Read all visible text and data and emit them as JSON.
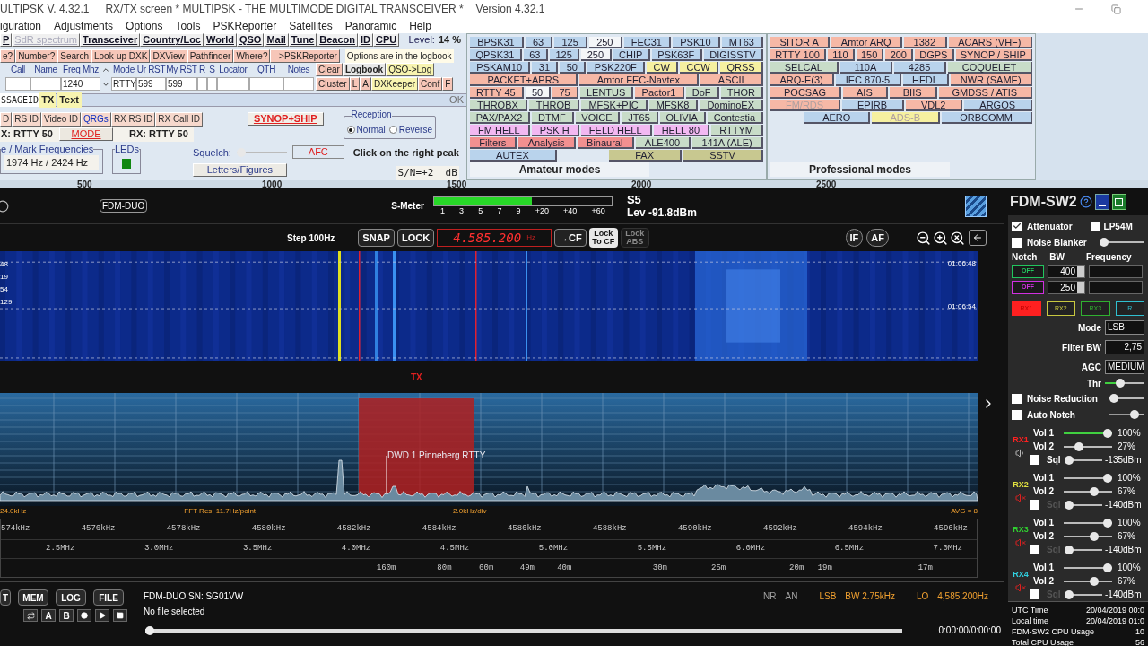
{
  "title_bar": {
    "app": "ULTIPSK V. 4.32.1",
    "screen": "RX/TX screen  * MULTIPSK - THE MULTIMODE DIGITAL TRANSCEIVER *",
    "version": "Version 4.32.1"
  },
  "menu": [
    "iguration",
    "Adjustments",
    "Options",
    "Tools",
    "PSKReporter",
    "Satellites",
    "Panoramic",
    "Help"
  ],
  "toolbar": {
    "buttons": [
      {
        "label": "P",
        "disabled": false
      },
      {
        "label": "SdR spectrum",
        "disabled": true
      },
      {
        "label": "Transceiver",
        "disabled": false
      },
      {
        "label": "Country/Loc",
        "disabled": false
      },
      {
        "label": "World",
        "disabled": false
      },
      {
        "label": "QSO",
        "disabled": false
      },
      {
        "label": "Mail",
        "disabled": false
      },
      {
        "label": "Tune",
        "disabled": false
      },
      {
        "label": "Beacon",
        "disabled": false
      },
      {
        "label": "ID",
        "disabled": false
      },
      {
        "label": "CPU",
        "disabled": false
      }
    ],
    "level_label": "Level:",
    "level_value": "14 %"
  },
  "lookup_buttons": [
    "e?",
    "Number?",
    "Search",
    "Look-up DXK",
    "DXView",
    "Pathfinder",
    "Where?",
    "-->PSKReporter"
  ],
  "logbook_note": "Options are in the logbook",
  "log_fields": [
    {
      "header": "Call"
    },
    {
      "header": "Name"
    },
    {
      "header": "Freq Mhz",
      "value": "1240"
    },
    {
      "header": "Mode",
      "value": "RTTY"
    },
    {
      "header": "Ur RST",
      "value": "599"
    },
    {
      "header": "My RST",
      "value": "599"
    },
    {
      "header": "R"
    },
    {
      "header": "S"
    },
    {
      "header": "Locator"
    },
    {
      "header": "QTH"
    },
    {
      "header": "Notes"
    }
  ],
  "log_buttons": [
    [
      {
        "label": "Clear",
        "color": "#f6c6b8"
      },
      {
        "label": "Logbook",
        "color": "#e8e8e8"
      },
      {
        "label": "QSO->Log",
        "color": "#f8f4b0"
      }
    ],
    [
      {
        "label": "Cluster",
        "color": "#f6c6b8"
      },
      {
        "label": "L",
        "color": "#f6c6b8"
      },
      {
        "label": "A",
        "color": "#f6c6b8"
      },
      {
        "label": "DXKeeper",
        "color": "#f8f4b0"
      },
      {
        "label": "Conf",
        "color": "#f6c6b8"
      },
      {
        "label": "F",
        "color": "#f6c6b8"
      }
    ]
  ],
  "message": {
    "prefix": "SSAGEID",
    "tx": "TX",
    "text": "Text",
    "ok": "OK"
  },
  "id_buttons": [
    {
      "label": "D",
      "kind": "plain"
    },
    {
      "label": "RS ID",
      "kind": "plain"
    },
    {
      "label": "Video ID",
      "kind": "plain"
    },
    {
      "label": "QRGs",
      "kind": "link"
    },
    {
      "label": "RX RS ID",
      "kind": "plain"
    },
    {
      "label": "RX Call ID",
      "kind": "plain"
    }
  ],
  "tx_mode": "X: RTTY 50",
  "mode_button": "MODE",
  "rx_mode": "RX: RTTY 50",
  "synop_button": "SYNOP+SHIP",
  "reception": {
    "title": "Reception",
    "options": [
      {
        "label": "Normal",
        "selected": true
      },
      {
        "label": "Reverse",
        "selected": false
      }
    ]
  },
  "frequencies": {
    "title": "e / Mark Frequencies",
    "value": "1974 Hz / 2424 Hz"
  },
  "leds": {
    "title": "LEDs",
    "on": true
  },
  "squelch": {
    "label": "Squelch:",
    "level": 0
  },
  "afc": "AFC",
  "letters_figures": "Letters/Figures",
  "hint": "Click on the right peak",
  "snr": "S/N=+2  dB",
  "audio_scale": [
    "500",
    "1000",
    "1500",
    "2000",
    "2500"
  ],
  "amateur_modes": {
    "title": "Amateur modes",
    "rows": [
      {
        "buttons": [
          {
            "kind": "button",
            "label": "BPSK31",
            "color": "#b9d3ec"
          },
          {
            "kind": "button",
            "label": "63",
            "color": "#b9d3ec"
          },
          {
            "kind": "button",
            "label": "125",
            "color": "#b9d3ec"
          },
          {
            "kind": "button",
            "label": "250",
            "color": "#f4f6f8"
          },
          {
            "kind": "button",
            "label": "FEC31",
            "color": "#b9d3ec"
          },
          {
            "kind": "button",
            "label": "PSK10",
            "color": "#b9d3ec"
          },
          {
            "kind": "button",
            "label": "MT63",
            "color": "#b9d3ec"
          }
        ]
      },
      {
        "buttons": [
          {
            "kind": "button",
            "label": "QPSK31",
            "color": "#b9d3ec"
          },
          {
            "kind": "button",
            "label": "63",
            "color": "#b9d3ec"
          },
          {
            "kind": "button",
            "label": "125",
            "color": "#b9d3ec"
          },
          {
            "kind": "button",
            "label": "250",
            "color": "#f4f6f8"
          },
          {
            "kind": "button",
            "label": "CHIP",
            "color": "#b9d3ec"
          },
          {
            "kind": "button",
            "label": "PSK63F",
            "color": "#b9d3ec"
          },
          {
            "kind": "button",
            "label": "DIGISSTV",
            "color": "#b9d3ec"
          }
        ]
      },
      {
        "buttons": [
          {
            "kind": "button",
            "label": "PSKAM10",
            "color": "#b9d3ec"
          },
          {
            "kind": "button",
            "label": "31",
            "color": "#b9d3ec"
          },
          {
            "kind": "button",
            "label": "50",
            "color": "#b9d3ec"
          },
          {
            "kind": "button",
            "label": "PSK220F",
            "color": "#b9d3ec"
          },
          {
            "kind": "button",
            "label": "CW",
            "color": "#f6f0a0"
          },
          {
            "kind": "button",
            "label": "CCW",
            "color": "#f6f0a0"
          },
          {
            "kind": "button",
            "label": "QRSS",
            "color": "#f6f0a0"
          }
        ]
      },
      {
        "buttons": [
          {
            "kind": "button",
            "label": "PACKET+APRS",
            "color": "#f6b8a6"
          },
          {
            "kind": "button",
            "label": "Amtor FEC-Navtex",
            "color": "#f6b8a6"
          },
          {
            "kind": "button",
            "label": "ASCII",
            "color": "#f6b8a6"
          }
        ]
      },
      {
        "buttons": [
          {
            "kind": "button",
            "label": "RTTY 45",
            "color": "#f6b8a6"
          },
          {
            "kind": "button",
            "label": "50",
            "color": "#f4f6f8"
          },
          {
            "kind": "button",
            "label": "75",
            "color": "#f6b8a6"
          },
          {
            "kind": "button",
            "label": "LENTUS",
            "color": "#c8dcc8"
          },
          {
            "kind": "button",
            "label": "Pactor1",
            "color": "#f6b8a6"
          },
          {
            "kind": "button",
            "label": "DoF",
            "color": "#c8dcc8"
          },
          {
            "kind": "button",
            "label": "THOR",
            "color": "#c8dcc8"
          }
        ]
      },
      {
        "buttons": [
          {
            "kind": "button",
            "label": "THROBX",
            "color": "#c8dcc8"
          },
          {
            "kind": "button",
            "label": "THROB",
            "color": "#c8dcc8"
          },
          {
            "kind": "button",
            "label": "MFSK+PIC",
            "color": "#c8dcc8"
          },
          {
            "kind": "button",
            "label": "MFSK8",
            "color": "#c8dcc8"
          },
          {
            "kind": "button",
            "label": "DominoEX",
            "color": "#c8dcc8"
          }
        ]
      },
      {
        "buttons": [
          {
            "kind": "button",
            "label": "PAX/PAX2",
            "color": "#c8dcc8"
          },
          {
            "kind": "button",
            "label": "DTMF",
            "color": "#c8dcc8"
          },
          {
            "kind": "button",
            "label": "VOICE",
            "color": "#c8dcc8"
          },
          {
            "kind": "button",
            "label": "JT65",
            "color": "#c8dcc8"
          },
          {
            "kind": "button",
            "label": "OLIVIA",
            "color": "#c8dcc8"
          },
          {
            "kind": "button",
            "label": "Contestia",
            "color": "#c8dcc8"
          }
        ]
      },
      {
        "buttons": [
          {
            "kind": "button",
            "label": "FM HELL",
            "color": "#f2b8f2"
          },
          {
            "kind": "button",
            "label": "PSK H",
            "color": "#f2b8f2"
          },
          {
            "kind": "button",
            "label": "FELD HELL",
            "color": "#f2b8f2"
          },
          {
            "kind": "button",
            "label": "HELL 80",
            "color": "#f2b8f2"
          },
          {
            "kind": "button",
            "label": "RTTYM",
            "color": "#c8dcc8"
          }
        ]
      },
      {
        "buttons": [
          {
            "kind": "button",
            "label": "Filters",
            "color": "#f29090"
          },
          {
            "kind": "button",
            "label": "Analysis",
            "color": "#f29090"
          },
          {
            "kind": "button",
            "label": "Binaural",
            "color": "#f29090"
          },
          {
            "kind": "button",
            "label": "ALE400",
            "color": "#c8dcc8"
          },
          {
            "kind": "button",
            "label": "141A (ALE)",
            "color": "#c8dcc8"
          }
        ]
      },
      {
        "buttons": [
          {
            "kind": "button",
            "label": "AUTEX",
            "color": "#b9d3ec"
          },
          {
            "kind": "spacer"
          },
          {
            "kind": "button",
            "label": "FAX",
            "color": "#c8c890"
          },
          {
            "kind": "button",
            "label": "SSTV",
            "color": "#c8c890"
          }
        ]
      }
    ]
  },
  "professional_modes": {
    "title": "Professional modes",
    "rows": [
      {
        "buttons": [
          {
            "kind": "button",
            "label": "SITOR A",
            "color": "#f6b8a6",
            "disabled": false
          },
          {
            "kind": "button",
            "label": "Amtor ARQ",
            "color": "#f6b8a6",
            "disabled": false
          },
          {
            "kind": "button",
            "label": "1382",
            "color": "#f6b8a6",
            "disabled": false
          },
          {
            "kind": "button",
            "label": "ACARS (VHF)",
            "color": "#f6b8a6",
            "disabled": false
          }
        ]
      },
      {
        "buttons": [
          {
            "kind": "button",
            "label": "RTTY 100",
            "color": "#f6b8a6",
            "disabled": false
          },
          {
            "kind": "button",
            "label": "110",
            "color": "#f6b8a6",
            "disabled": false
          },
          {
            "kind": "button",
            "label": "150",
            "color": "#f6b8a6",
            "disabled": false
          },
          {
            "kind": "button",
            "label": "200",
            "color": "#f6b8a6",
            "disabled": false
          },
          {
            "kind": "button",
            "label": "DGPS",
            "color": "#f6b8a6",
            "disabled": false
          },
          {
            "kind": "button",
            "label": "SYNOP / SHIP",
            "color": "#f6b8a6",
            "disabled": false
          }
        ]
      },
      {
        "buttons": [
          {
            "kind": "button",
            "label": "SELCAL",
            "color": "#c8dcc8",
            "disabled": false
          },
          {
            "kind": "button",
            "label": "110A",
            "color": "#b9d3ec",
            "disabled": false
          },
          {
            "kind": "button",
            "label": "4285",
            "color": "#b9d3ec",
            "disabled": false
          },
          {
            "kind": "button",
            "label": "COQUELET",
            "color": "#c8dcc8",
            "disabled": false
          }
        ]
      },
      {
        "buttons": [
          {
            "kind": "button",
            "label": "ARQ-E(3)",
            "color": "#f6b8a6",
            "disabled": false
          },
          {
            "kind": "button",
            "label": "IEC 870-5",
            "color": "#b9d3ec",
            "disabled": false
          },
          {
            "kind": "button",
            "label": "HFDL",
            "color": "#b9d3ec",
            "disabled": false
          },
          {
            "kind": "button",
            "label": "NWR (SAME)",
            "color": "#f6b8a6",
            "disabled": false
          }
        ]
      },
      {
        "buttons": [
          {
            "kind": "button",
            "label": "POCSAG",
            "color": "#f6b8a6",
            "disabled": false
          },
          {
            "kind": "button",
            "label": "AIS",
            "color": "#f6b8a6",
            "disabled": false
          },
          {
            "kind": "button",
            "label": "BIIS",
            "color": "#f6b8a6",
            "disabled": false
          },
          {
            "kind": "button",
            "label": "GMDSS / ATIS",
            "color": "#f6b8a6",
            "disabled": false
          }
        ]
      },
      {
        "buttons": [
          {
            "kind": "button",
            "label": "FM/RDS",
            "color": "#f6b8a6",
            "disabled": true
          },
          {
            "kind": "button",
            "label": "EPIRB",
            "color": "#b9d3ec",
            "disabled": false
          },
          {
            "kind": "button",
            "label": "VDL2",
            "color": "#f6b8a6",
            "disabled": false
          },
          {
            "kind": "button",
            "label": "ARGOS",
            "color": "#b9d3ec",
            "disabled": false
          }
        ]
      },
      {
        "buttons": [
          {
            "kind": "spacer"
          },
          {
            "kind": "button",
            "label": "AERO",
            "color": "#b9d3ec",
            "disabled": false
          },
          {
            "kind": "button",
            "label": "ADS-B",
            "color": "#f6f0a0",
            "disabled": true
          },
          {
            "kind": "button",
            "label": "ORBCOMM",
            "color": "#b9d3ec",
            "disabled": false
          }
        ]
      }
    ]
  },
  "sdr": {
    "device_badge": "FDM-DUO",
    "smeter": {
      "label": "S-Meter",
      "level": 0.55,
      "scale": [
        "1",
        "3",
        "5",
        "7",
        "9",
        "+20",
        "+40",
        "+60"
      ],
      "reading": "S5",
      "level_text": "Lev -91.8dBm"
    },
    "step": "Step 100Hz",
    "snap": "SNAP",
    "lock": "LOCK",
    "frequency": "4.585.200",
    "freq_unit": "Hz",
    "to_cf": "→CF",
    "lock_cf": {
      "label": "Lock To CF",
      "on": true
    },
    "lock_abs": {
      "label": "Lock ABS",
      "on": false
    },
    "if": "IF",
    "af": "AF",
    "waterfall": {
      "left_times": [
        "48",
        "19",
        "54",
        "129"
      ],
      "right_times": [
        "01:06:48",
        "01:06:54"
      ]
    },
    "tx_marker": "TX",
    "spectrum": {
      "station": "DWD 1 Pinneberg RTTY",
      "span": "24.0kHz",
      "fft": "FFT Res. 11.7Hz/point",
      "div": "2.0kHz/div",
      "avg": "AVG = 8"
    },
    "khz_scale": [
      "574kHz",
      "4576kHz",
      "4578kHz",
      "4580kHz",
      "4582kHz",
      "4584kHz",
      "4586kHz",
      "4588kHz",
      "4590kHz",
      "4592kHz",
      "4594kHz",
      "4596kHz"
    ],
    "mhz_scale": [
      "2.5MHz",
      "3.0MHz",
      "3.5MHz",
      "4.0MHz",
      "4.5MHz",
      "5.0MHz",
      "5.5MHz",
      "6.0MHz",
      "6.5MHz",
      "7.0MHz"
    ],
    "bands": [
      "160m",
      "80m",
      "60m",
      "49m",
      "40m",
      "30m",
      "25m",
      "20m",
      "19m",
      "17m"
    ]
  },
  "bottom": {
    "buttons": [
      "T",
      "MEM",
      "LOG",
      "FILE"
    ],
    "media_buttons": [
      {
        "kind": "loop"
      },
      {
        "kind": "text",
        "label": "A"
      },
      {
        "kind": "text",
        "label": "B"
      },
      {
        "kind": "record"
      },
      {
        "kind": "play"
      },
      {
        "kind": "stop"
      }
    ],
    "serial": "FDM-DUO SN: SG01VW",
    "file": "No file selected",
    "status": [
      {
        "text": "NR",
        "color": "#a0a0a0"
      },
      {
        "text": "AN",
        "color": "#a0a0a0"
      },
      {
        "text": "LSB",
        "color": "#f0a030"
      },
      {
        "text": "BW 2.75kHz",
        "color": "#f0a030"
      },
      {
        "text": "LO",
        "color": "#f0a030"
      },
      {
        "text": "4,585,200Hz",
        "color": "#f0a030"
      }
    ],
    "playback": {
      "level": 0
    },
    "time": "0:00:00/0:00:00"
  },
  "panel": {
    "title": "FDM-SW2",
    "attenuator": {
      "label": "Attenuator",
      "checked": true
    },
    "lp": {
      "label": "LP54M",
      "checked": false
    },
    "noise_blanker": {
      "label": "Noise Blanker",
      "checked": false,
      "level": 0
    },
    "notch_headers": [
      "Notch",
      "BW",
      "Frequency"
    ],
    "notches": [
      {
        "state": "OFF",
        "color": "#22c55e",
        "bw": "400"
      },
      {
        "state": "OFF",
        "color": "#d030e0",
        "bw": "250"
      }
    ],
    "rx_tabs": [
      {
        "label": "RX1",
        "color": "#ff2020",
        "selected": true
      },
      {
        "label": "RX2",
        "color": "#c8c840",
        "selected": false
      },
      {
        "label": "RX3",
        "color": "#30b030",
        "selected": false
      },
      {
        "label": "R",
        "color": "#30c0d0",
        "selected": false
      }
    ],
    "mode": {
      "label": "Mode",
      "value": "LSB"
    },
    "filter_bw": {
      "label": "Filter BW",
      "value": "2,75"
    },
    "agc": {
      "label": "AGC",
      "value": "MEDIUM"
    },
    "thr": {
      "label": "Thr",
      "level": 0.35
    },
    "noise_reduction": {
      "label": "Noise Reduction",
      "checked": false,
      "level": 0
    },
    "auto_notch": {
      "label": "Auto Notch",
      "checked": false,
      "level": 0.8
    },
    "receivers": [
      {
        "name": "RX1",
        "color": "#ff2020",
        "muted": false,
        "vol1": {
          "label": "Vol 1",
          "level": 1,
          "reading": "100%"
        },
        "vol2": {
          "label": "Vol 2",
          "level": 0.27,
          "reading": "27%"
        },
        "sql": {
          "label": "Sql",
          "checked": false,
          "enabled": true,
          "level": 0,
          "reading": "-135dBm"
        }
      },
      {
        "name": "RX2",
        "color": "#e0e040",
        "muted": true,
        "vol1": {
          "label": "Vol 1",
          "level": 1,
          "reading": "100%"
        },
        "vol2": {
          "label": "Vol 2",
          "level": 0.67,
          "reading": "67%"
        },
        "sql": {
          "label": "Sql",
          "checked": false,
          "enabled": false,
          "level": 0,
          "reading": "-140dBm"
        }
      },
      {
        "name": "RX3",
        "color": "#30d030",
        "muted": true,
        "vol1": {
          "label": "Vol 1",
          "level": 1,
          "reading": "100%"
        },
        "vol2": {
          "label": "Vol 2",
          "level": 0.67,
          "reading": "67%"
        },
        "sql": {
          "label": "Sql",
          "checked": false,
          "enabled": false,
          "level": 0,
          "reading": "-140dBm"
        }
      },
      {
        "name": "RX4",
        "color": "#30d0e0",
        "muted": true,
        "vol1": {
          "label": "Vol 1",
          "level": 1,
          "reading": "100%"
        },
        "vol2": {
          "label": "Vol 2",
          "level": 0.67,
          "reading": "67%"
        },
        "sql": {
          "label": "Sql",
          "checked": false,
          "enabled": false,
          "level": 0,
          "reading": "-140dBm"
        }
      }
    ],
    "stats": [
      {
        "label": "UTC Time",
        "value": "20/04/2019 00:0"
      },
      {
        "label": "Local time",
        "value": "20/04/2019 01:0"
      },
      {
        "label": "FDM-SW2 CPU Usage",
        "value": "10"
      },
      {
        "label": "Total CPU Usage",
        "value": "56"
      }
    ]
  }
}
